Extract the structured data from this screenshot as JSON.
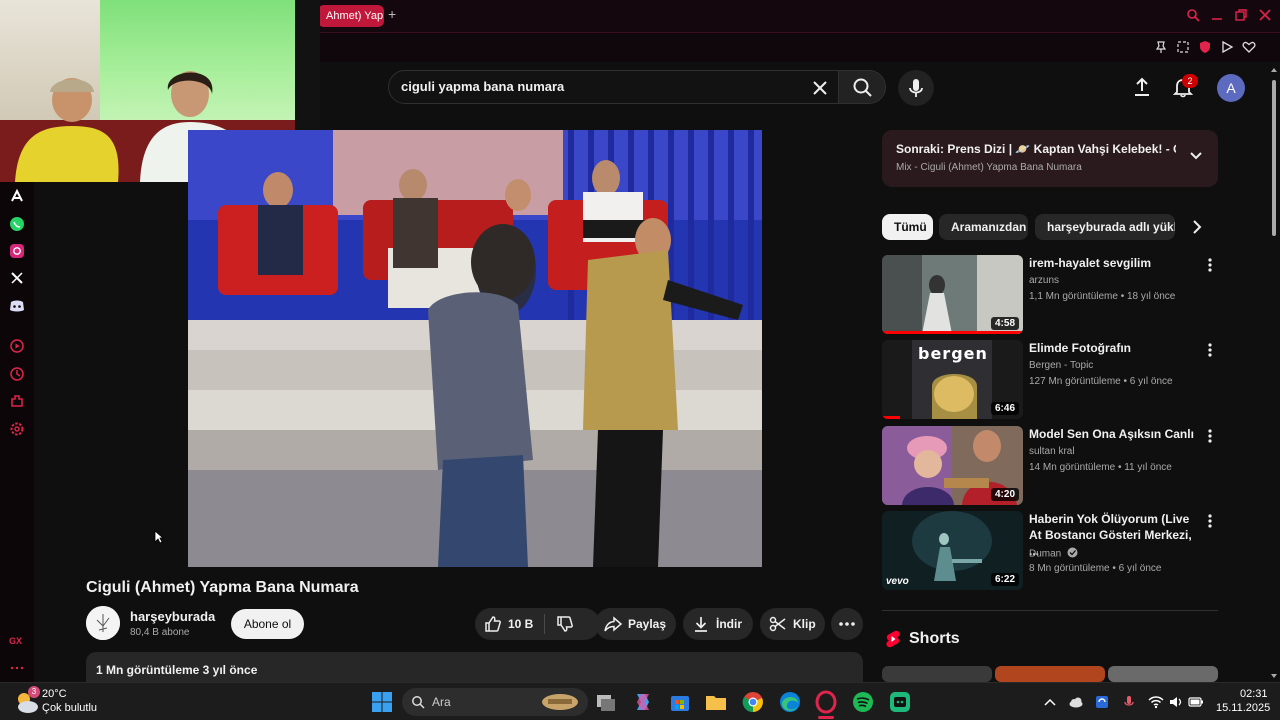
{
  "browser": {
    "tab_title": "Ahmet) Yap",
    "new_tab": "+"
  },
  "search": {
    "query": "ciguli yapma bana numara"
  },
  "header": {
    "notification_count": "2",
    "avatar_letter": "A"
  },
  "video": {
    "title": "Ciguli (Ahmet) Yapma Bana Numara",
    "channel_name": "harşeyburada",
    "subscribers": "80,4 B abone",
    "subscribe_label": "Abone ol",
    "likes": "10 B",
    "share_label": "Paylaş",
    "download_label": "İndir",
    "clip_label": "Klip",
    "views_and_date": "1 Mn görüntüleme  3 yıl önce"
  },
  "next_up": {
    "title": "Sonraki: Prens Dizi | 🪐 Kaptan Vahşi Kelebek! - Off...",
    "subtitle": "Mix - Ciguli (Ahmet) Yapma Bana Numara"
  },
  "chips": [
    "Tümü",
    "Aramanızdan",
    "harşeyburada adlı yükleyen"
  ],
  "recommendations": [
    {
      "title": "irem-hayalet sevgilim",
      "channel": "arzuns",
      "meta": "1,1 Mn görüntüleme • 18 yıl önce",
      "duration": "4:58"
    },
    {
      "title": "Elimde Fotoğrafın",
      "channel": "Bergen - Topic",
      "meta": "127 Mn görüntüleme • 6 yıl önce",
      "duration": "6:46"
    },
    {
      "title": "Model  Sen Ona Aşıksın Canlı",
      "channel": "sultan kral",
      "meta": "14 Mn görüntüleme • 11 yıl önce",
      "duration": "4:20"
    },
    {
      "title": "Haberin Yok Ölüyorum (Live At Bostancı Gösteri Merkezi, ...",
      "channel": "Duman",
      "meta": "8 Mn görüntüleme • 6 yıl önce",
      "duration": "6:22"
    }
  ],
  "thumb_texts": {
    "bergen_logo": "bergen",
    "vevo": "vevo"
  },
  "shorts": {
    "title": "Shorts"
  },
  "taskbar": {
    "temperature": "20°C",
    "weather": "Çok bulutlu",
    "weather_badge": "3",
    "search_placeholder": "Ara",
    "time": "02:31",
    "date": "15.11.2025"
  }
}
